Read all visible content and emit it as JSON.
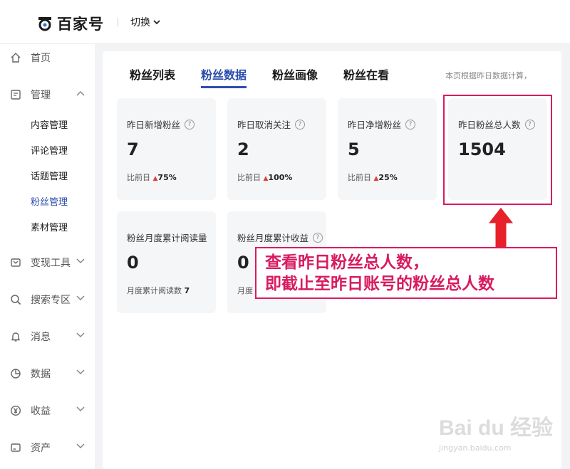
{
  "header": {
    "logo_text": "百家号",
    "switch_label": "切换"
  },
  "sidebar": {
    "home": "首页",
    "manage": "管理",
    "sub_items": [
      "内容管理",
      "评论管理",
      "话题管理",
      "粉丝管理",
      "素材管理"
    ],
    "monetize": "变现工具",
    "search": "搜索专区",
    "messages": "消息",
    "data": "数据",
    "income": "收益",
    "assets": "资产"
  },
  "tabs": [
    "粉丝列表",
    "粉丝数据",
    "粉丝画像",
    "粉丝在看"
  ],
  "note": "本页根据昨日数据计算，",
  "cards": [
    {
      "title": "昨日新增粉丝",
      "value": "7",
      "compare_label": "比前日",
      "compare_value": "75%"
    },
    {
      "title": "昨日取消关注",
      "value": "2",
      "compare_label": "比前日",
      "compare_value": "100%"
    },
    {
      "title": "昨日净增粉丝",
      "value": "5",
      "compare_label": "比前日",
      "compare_value": "25%"
    },
    {
      "title": "昨日粉丝总人数",
      "value": "1504"
    },
    {
      "title": "粉丝月度累计阅读量",
      "value": "0",
      "compare_label": "月度累计阅读数",
      "compare_value": "7"
    },
    {
      "title": "粉丝月度累计收益",
      "value": "0",
      "compare_label": "月度"
    }
  ],
  "callout": {
    "line1": "查看昨日粉丝总人数，",
    "line2": "即截止至昨日账号的粉丝总人数"
  },
  "watermark": {
    "brand": "Bai du 经验",
    "url": "jingyan.baidu.com"
  },
  "colors": {
    "accent": "#2b4dab",
    "highlight": "#d81b60",
    "increase": "#e03d3d"
  }
}
